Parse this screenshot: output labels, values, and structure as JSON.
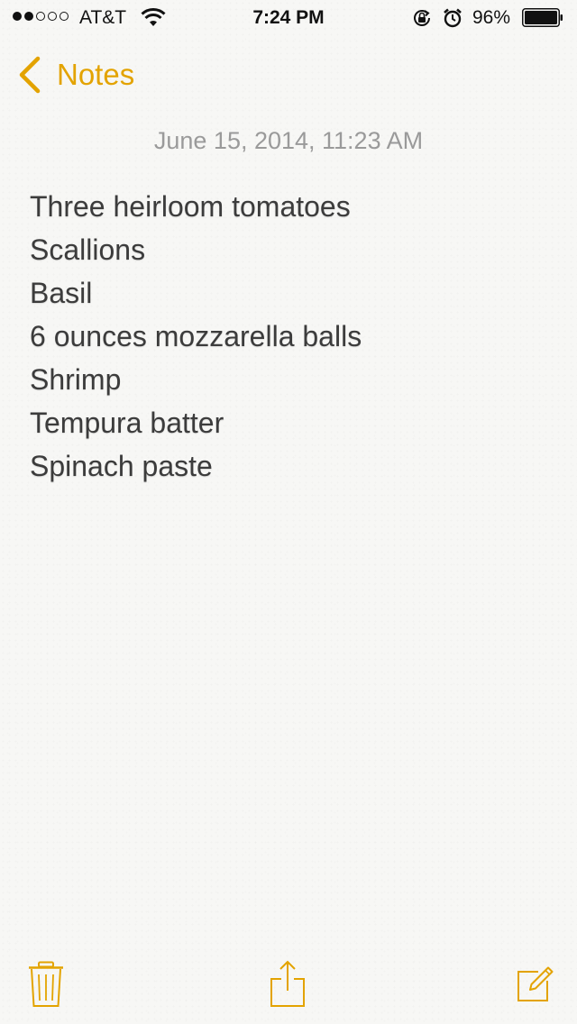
{
  "status_bar": {
    "signal_strength": 2,
    "signal_max": 5,
    "carrier": "AT&T",
    "time": "7:24 PM",
    "battery_percent": "96%"
  },
  "nav": {
    "back_label": "Notes"
  },
  "note": {
    "date": "June 15, 2014, 11:23 AM",
    "lines": [
      "Three heirloom tomatoes",
      "Scallions",
      "Basil",
      "6 ounces mozzarella balls",
      "Shrimp",
      "Tempura batter",
      "Spinach paste"
    ]
  },
  "toolbar": {
    "icons": [
      "trash-icon",
      "share-icon",
      "compose-icon"
    ]
  },
  "colors": {
    "accent": "#e3a300",
    "text": "#3c3c3c",
    "date_text": "#9a9a9a",
    "background": "#f7f7f5"
  }
}
